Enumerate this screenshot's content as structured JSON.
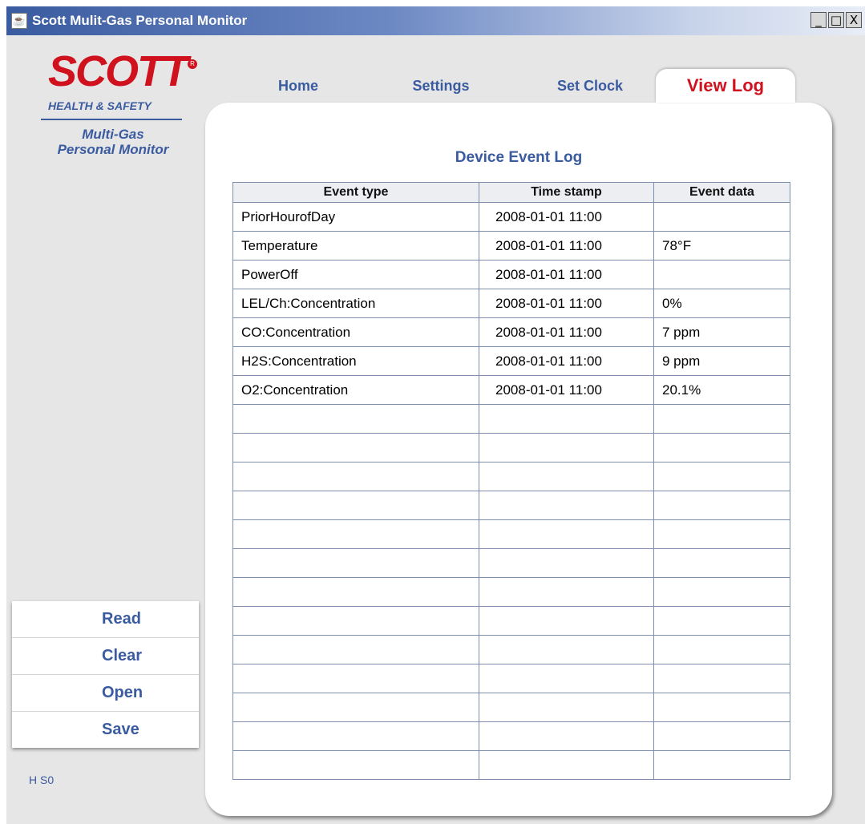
{
  "window": {
    "title": "Scott Mulit-Gas Personal Monitor",
    "controls": {
      "minimize": "_",
      "maximize": "□",
      "close": "X"
    }
  },
  "brand": {
    "logo_text": "SCOTT",
    "registered": "R",
    "subtitle": "HEALTH & SAFETY",
    "product_line1": "Multi-Gas",
    "product_line2": "Personal Monitor",
    "logo_color": "#d0121f",
    "accent_color": "#3a5ba0"
  },
  "tabs": [
    {
      "label": "Home",
      "active": false
    },
    {
      "label": "Settings",
      "active": false
    },
    {
      "label": "Set Clock",
      "active": false
    },
    {
      "label": "View Log",
      "active": true
    }
  ],
  "log": {
    "title": "Device Event Log",
    "columns": [
      "Event type",
      "Time stamp",
      "Event data"
    ],
    "rows": [
      [
        "PriorHourofDay",
        "2008-01-01 11:00",
        ""
      ],
      [
        "Temperature",
        "2008-01-01 11:00",
        "78°F"
      ],
      [
        "PowerOff",
        "2008-01-01 11:00",
        ""
      ],
      [
        "LEL/Ch:Concentration",
        "2008-01-01 11:00",
        "0%"
      ],
      [
        "CO:Concentration",
        "2008-01-01 11:00",
        "7 ppm"
      ],
      [
        "H2S:Concentration",
        "2008-01-01 11:00",
        "9 ppm"
      ],
      [
        "O2:Concentration",
        "2008-01-01 11:00",
        "20.1%"
      ]
    ],
    "empty_rows": 13
  },
  "actions": [
    "Read",
    "Clear",
    "Open",
    "Save"
  ],
  "status": "H S0"
}
